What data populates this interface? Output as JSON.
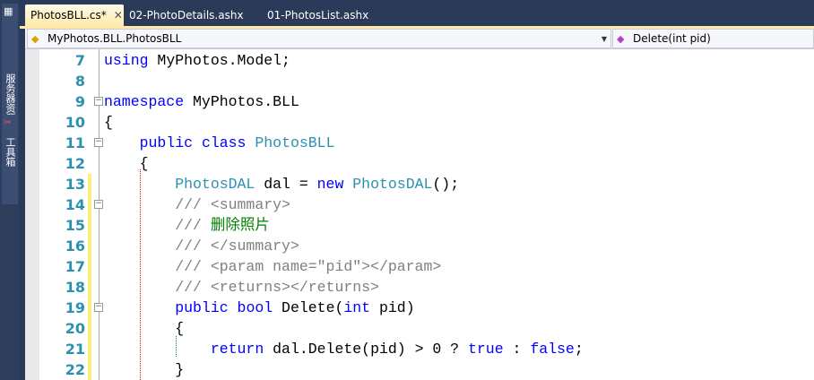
{
  "sidebar": {
    "items": [
      {
        "label": "服务器资源管理器",
        "icon": "server-explorer-icon"
      },
      {
        "label": "工具箱",
        "icon": "toolbox-icon"
      }
    ]
  },
  "tabs": [
    {
      "label": "PhotosBLL.cs*",
      "active": true,
      "close": "✕"
    },
    {
      "label": "02-PhotoDetails.ashx"
    },
    {
      "label": "01-PhotosList.ashx"
    }
  ],
  "navbar": {
    "type_combo": "MyPhotos.BLL.PhotosBLL",
    "member_combo": "Delete(int pid)"
  },
  "colors": {
    "keyword": "#0000ff",
    "type": "#2b91af",
    "comment": "#808080",
    "line_number": "#2b91af"
  },
  "code": [
    {
      "n": "7",
      "t": [
        [
          "kw",
          "using"
        ],
        [
          "tx",
          " MyPhotos.Model;"
        ]
      ]
    },
    {
      "n": "8",
      "t": []
    },
    {
      "n": "9",
      "fold": "−",
      "t": [
        [
          "kw",
          "namespace"
        ],
        [
          "tx",
          " MyPhotos.BLL"
        ]
      ]
    },
    {
      "n": "10",
      "t": [
        [
          "tx",
          "{"
        ]
      ]
    },
    {
      "n": "11",
      "fold": "−",
      "t": [
        [
          "tx",
          "    "
        ],
        [
          "kw",
          "public"
        ],
        [
          "tx",
          " "
        ],
        [
          "kw",
          "class"
        ],
        [
          "tx",
          " "
        ],
        [
          "ty",
          "PhotosBLL"
        ]
      ]
    },
    {
      "n": "12",
      "t": [
        [
          "tx",
          "    {"
        ]
      ]
    },
    {
      "n": "13",
      "chg": true,
      "t": [
        [
          "tx",
          "        "
        ],
        [
          "ty",
          "PhotosDAL"
        ],
        [
          "tx",
          " dal = "
        ],
        [
          "kw",
          "new"
        ],
        [
          "tx",
          " "
        ],
        [
          "ty",
          "PhotosDAL"
        ],
        [
          "tx",
          "();"
        ]
      ]
    },
    {
      "n": "14",
      "chg": true,
      "fold": "−",
      "t": [
        [
          "tx",
          "        "
        ],
        [
          "cm",
          "/// <summary>"
        ]
      ]
    },
    {
      "n": "15",
      "chg": true,
      "t": [
        [
          "tx",
          "        "
        ],
        [
          "cm",
          "/// "
        ],
        [
          "cg",
          "删除照片"
        ]
      ]
    },
    {
      "n": "16",
      "chg": true,
      "t": [
        [
          "tx",
          "        "
        ],
        [
          "cm",
          "/// </summary>"
        ]
      ]
    },
    {
      "n": "17",
      "chg": true,
      "t": [
        [
          "tx",
          "        "
        ],
        [
          "cm",
          "/// <param name=\"pid\"></param>"
        ]
      ]
    },
    {
      "n": "18",
      "chg": true,
      "t": [
        [
          "tx",
          "        "
        ],
        [
          "cm",
          "/// <returns></returns>"
        ]
      ]
    },
    {
      "n": "19",
      "chg": true,
      "fold": "−",
      "t": [
        [
          "tx",
          "        "
        ],
        [
          "kw",
          "public"
        ],
        [
          "tx",
          " "
        ],
        [
          "kw",
          "bool"
        ],
        [
          "tx",
          " Delete("
        ],
        [
          "kw",
          "int"
        ],
        [
          "tx",
          " pid)"
        ]
      ]
    },
    {
      "n": "20",
      "chg": true,
      "t": [
        [
          "tx",
          "        {"
        ]
      ]
    },
    {
      "n": "21",
      "chg": true,
      "t": [
        [
          "tx",
          "            "
        ],
        [
          "kw",
          "return"
        ],
        [
          "tx",
          " dal.Delete(pid) > 0 ? "
        ],
        [
          "kw",
          "true"
        ],
        [
          "tx",
          " : "
        ],
        [
          "kw",
          "false"
        ],
        [
          "tx",
          ";"
        ]
      ]
    },
    {
      "n": "22",
      "chg": true,
      "t": [
        [
          "tx",
          "        }"
        ]
      ]
    }
  ]
}
